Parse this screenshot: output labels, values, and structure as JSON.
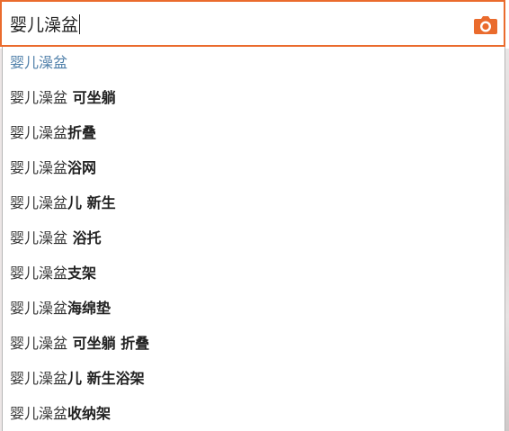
{
  "search": {
    "value": "婴儿澡盆"
  },
  "icons": {
    "camera": "camera-icon",
    "accent_color": "#ea6b2d"
  },
  "suggestions": [
    {
      "base": "婴儿澡盆",
      "extra": ""
    },
    {
      "base": "婴儿澡盆",
      "extra": " 可坐躺"
    },
    {
      "base": "婴儿澡盆",
      "extra": "折叠"
    },
    {
      "base": "婴儿澡盆",
      "extra": "浴网"
    },
    {
      "base": "婴儿澡盆",
      "extra": "儿 新生"
    },
    {
      "base": "婴儿澡盆",
      "extra": " 浴托"
    },
    {
      "base": "婴儿澡盆",
      "extra": "支架"
    },
    {
      "base": "婴儿澡盆",
      "extra": "海绵垫"
    },
    {
      "base": "婴儿澡盆",
      "extra": " 可坐躺 折叠"
    },
    {
      "base": "婴儿澡盆",
      "extra": "儿 新生浴架"
    },
    {
      "base": "婴儿澡盆",
      "extra": "收纳架"
    }
  ]
}
